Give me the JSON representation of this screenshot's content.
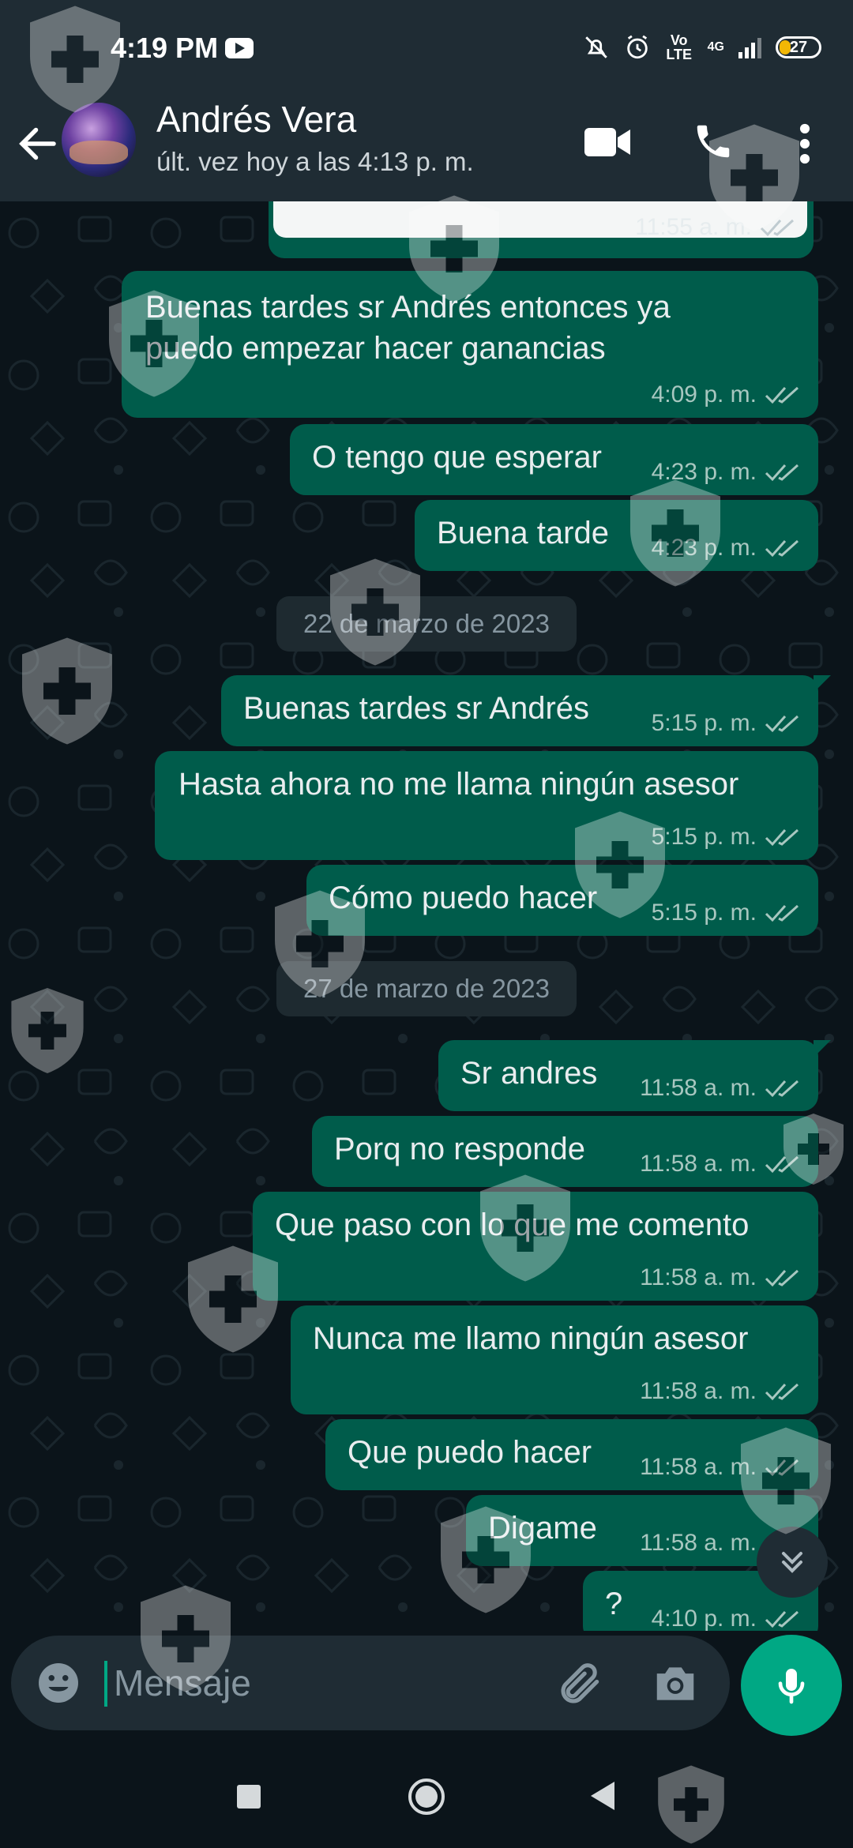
{
  "status_bar": {
    "time": "4:19 PM",
    "volte": "Vo LTE",
    "network": "4G",
    "battery_level": "27"
  },
  "header": {
    "contact_name": "Andrés Vera",
    "last_seen": "últ. vez hoy a las 4:13 p. m."
  },
  "messages": {
    "m0": {
      "text": "",
      "time": "11:55 a. m."
    },
    "m1": {
      "text_line1": "Buenas tardes sr Andrés entonces ya",
      "text_line2": "puedo empezar hacer ganancias",
      "time": "4:09 p. m."
    },
    "m2": {
      "text": "O tengo que esperar",
      "time": "4:23 p. m."
    },
    "m3": {
      "text": "Buena tarde",
      "time": "4:23 p. m."
    },
    "date1": "22 de marzo de 2023",
    "m4": {
      "text": "Buenas tardes sr Andrés",
      "time": "5:15 p. m."
    },
    "m5": {
      "text": "Hasta ahora no me llama ningún asesor",
      "time": "5:15 p. m."
    },
    "m6": {
      "text": "Cómo puedo hacer",
      "time": "5:15 p. m."
    },
    "date2": "27 de marzo de 2023",
    "m7": {
      "text": "Sr andres",
      "time": "11:58 a. m."
    },
    "m8": {
      "text": "Porq no responde",
      "time": "11:58 a. m."
    },
    "m9": {
      "text": "Que paso con lo que me comento",
      "time": "11:58 a. m."
    },
    "m10": {
      "text": "Nunca me llamo ningún asesor",
      "time": "11:58 a. m."
    },
    "m11": {
      "text": "Que puedo hacer",
      "time": "11:58 a. m."
    },
    "m12": {
      "text": "Digame",
      "time": "11:58 a. m."
    },
    "m13": {
      "text": "?",
      "time": "4:10 p. m."
    }
  },
  "composer": {
    "placeholder": "Mensaje"
  },
  "colors": {
    "outgoing_bubble": "#005c4b",
    "header": "#1f2c34",
    "accent": "#00a884",
    "background": "#0b141a"
  },
  "icons": [
    "back-arrow-icon",
    "video-call-icon",
    "phone-icon",
    "more-vert-icon",
    "emoji-icon",
    "attach-icon",
    "camera-icon",
    "mic-icon",
    "scroll-down-icon"
  ]
}
